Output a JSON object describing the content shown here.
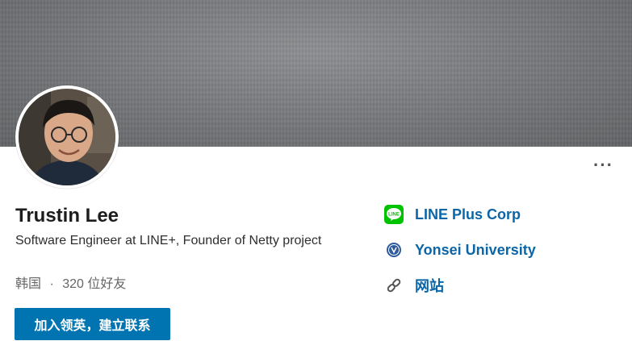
{
  "profile": {
    "name": "Trustin Lee",
    "headline": "Software Engineer at LINE+, Founder of Netty project",
    "location": "韩国",
    "separator": "·",
    "connections": "320 位好友",
    "more_menu": "···"
  },
  "actions": {
    "join_button": "加入领英，建立联系"
  },
  "links": {
    "company": {
      "label": "LINE Plus Corp",
      "icon": "line-logo-icon",
      "icon_text": "LINE",
      "color": "#00c300"
    },
    "school": {
      "label": "Yonsei University",
      "icon": "university-seal-icon"
    },
    "website": {
      "label": "网站",
      "icon": "link-icon"
    }
  },
  "colors": {
    "accent": "#0073b1",
    "link": "#0a66a8"
  }
}
